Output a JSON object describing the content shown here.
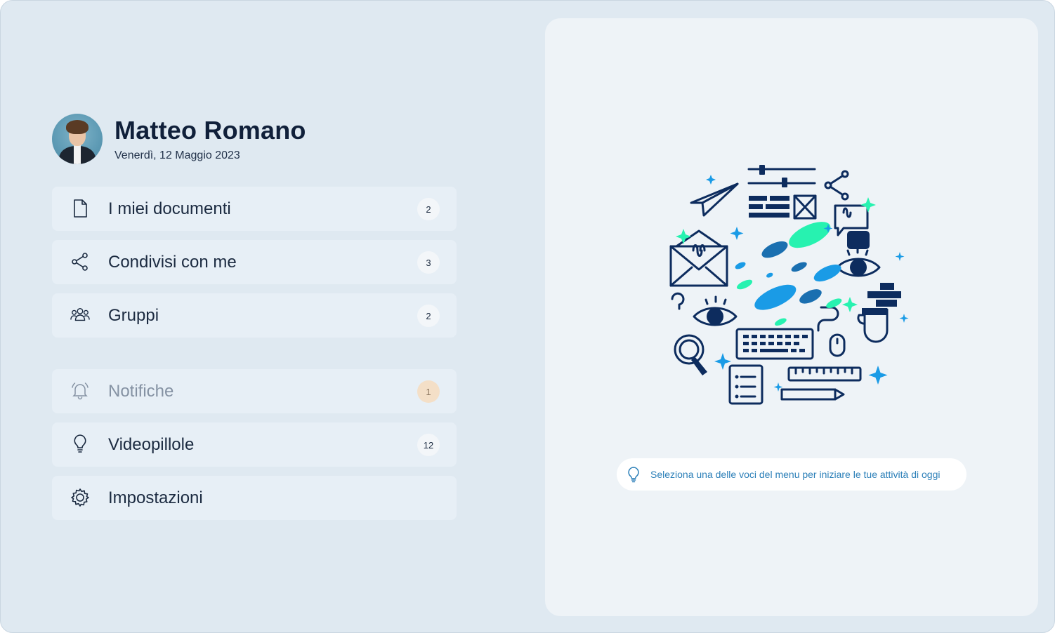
{
  "profile": {
    "name": "Matteo Romano",
    "date": "Venerdì, 12 Maggio 2023"
  },
  "menu": [
    {
      "label": "I miei documenti",
      "count": "2",
      "icon": "document-icon"
    },
    {
      "label": "Condivisi con me",
      "count": "3",
      "icon": "share-icon"
    },
    {
      "label": "Gruppi",
      "count": "2",
      "icon": "group-icon"
    },
    {
      "label": "Notifiche",
      "count": "1",
      "icon": "bell-icon",
      "state": "muted"
    },
    {
      "label": "Videopillole",
      "count": "12",
      "icon": "lightbulb-icon"
    },
    {
      "label": "Impostazioni",
      "count": "",
      "icon": "gear-icon"
    }
  ],
  "hint": {
    "text": "Seleziona una delle voci del menu per iniziare le tue attività di oggi",
    "icon": "lightbulb-icon"
  },
  "colors": {
    "background": "#dfe9f1",
    "panel": "#eef3f7",
    "menu_item": "#e7eff6",
    "navy": "#0d2c5e",
    "accent_blue": "#1a9be6",
    "accent_mint": "#27f2b0",
    "notification_badge": "#f4dfc7"
  }
}
